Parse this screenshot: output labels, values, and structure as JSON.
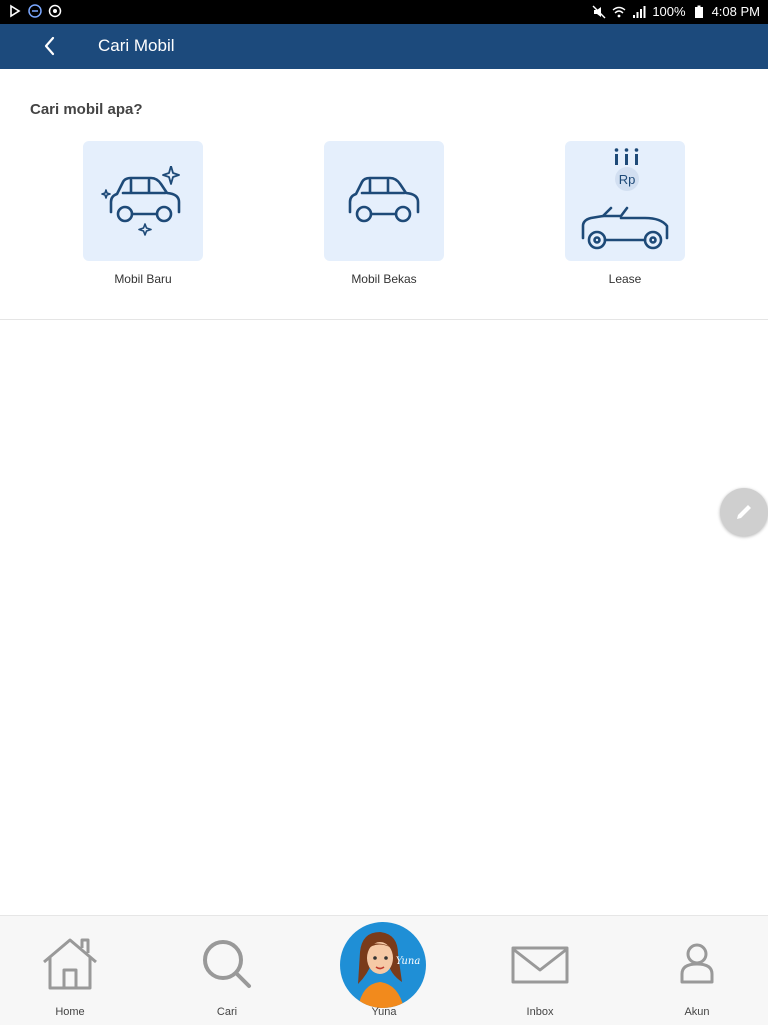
{
  "status_bar": {
    "battery": "100%",
    "time": "4:08 PM",
    "icons": [
      "play-store-icon",
      "app-icon",
      "sync-icon",
      "mute-icon",
      "wifi-icon",
      "signal-icon",
      "battery-icon"
    ]
  },
  "app_bar": {
    "title": "Cari Mobil",
    "background": "#1c4a7c"
  },
  "section": {
    "title": "Cari mobil apa?",
    "items": [
      {
        "label": "Mobil Baru",
        "icon": "new-car-icon"
      },
      {
        "label": "Mobil Bekas",
        "icon": "used-car-icon"
      },
      {
        "label": "Lease",
        "icon": "lease-car-icon",
        "badge": "Rp"
      }
    ]
  },
  "bottom_nav": {
    "items": [
      {
        "label": "Home",
        "icon": "home-icon"
      },
      {
        "label": "Cari",
        "icon": "search-icon"
      },
      {
        "label": "Yuna",
        "icon": "yuna-avatar",
        "avatar_text": "Yuna"
      },
      {
        "label": "Inbox",
        "icon": "mail-icon"
      },
      {
        "label": "Akun",
        "icon": "user-icon"
      }
    ]
  },
  "colors": {
    "accent": "#1c4a7c",
    "tile": "#e5effc",
    "icon_stroke": "#1e4a78"
  }
}
